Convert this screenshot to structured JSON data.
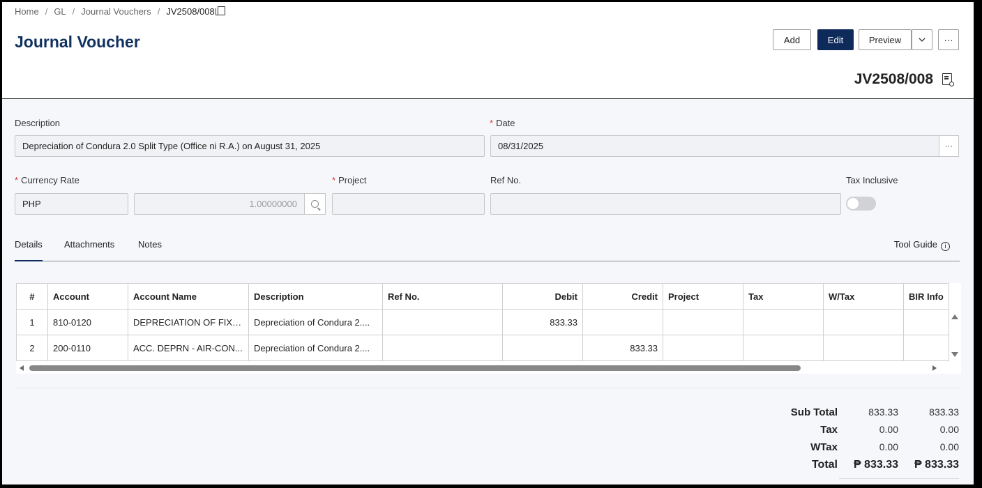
{
  "breadcrumb": [
    "Home",
    "GL",
    "Journal Vouchers",
    "JV2508/008"
  ],
  "page_title": "Journal Voucher",
  "toolbar": {
    "add": "Add",
    "edit": "Edit",
    "preview": "Preview",
    "dropdown_icon": "chevron-down-icon",
    "more": "···"
  },
  "doc_number": "JV2508/008",
  "form": {
    "description_label": "Description",
    "description_value": "Depreciation of Condura 2.0 Split Type (Office ni R.A.) on August 31, 2025",
    "date_label": "Date",
    "date_value": "08/31/2025",
    "date_more": "···",
    "currency_label": "Currency Rate",
    "currency_value": "PHP",
    "rate_value": "1.00000000",
    "project_label": "Project",
    "project_value": "",
    "ref_label": "Ref No.",
    "ref_value": "",
    "tax_inclusive_label": "Tax Inclusive",
    "tax_inclusive_on": false
  },
  "tabs": [
    "Details",
    "Attachments",
    "Notes"
  ],
  "active_tab": "Details",
  "tool_guide": "Tool Guide",
  "info_glyph": "i",
  "grid": {
    "columns": [
      "#",
      "Account",
      "Account Name",
      "Description",
      "Ref No.",
      "Debit",
      "Credit",
      "Project",
      "Tax",
      "W/Tax",
      "BIR Info"
    ],
    "rows": [
      {
        "no": "1",
        "account": "810-0120",
        "account_name": "DEPRECIATION OF FIXE...",
        "description": "Depreciation of Condura 2....",
        "ref_no": "",
        "debit": "833.33",
        "credit": "",
        "project": "",
        "tax": "",
        "wtax": "",
        "bir": ""
      },
      {
        "no": "2",
        "account": "200-0110",
        "account_name": "ACC. DEPRN - AIR-CON...",
        "description": "Depreciation of Condura 2....",
        "ref_no": "",
        "debit": "",
        "credit": "833.33",
        "project": "",
        "tax": "",
        "wtax": "",
        "bir": ""
      }
    ]
  },
  "totals": [
    {
      "label": "Sub Total",
      "debit": "833.33",
      "credit": "833.33"
    },
    {
      "label": "Tax",
      "debit": "0.00",
      "credit": "0.00"
    },
    {
      "label": "WTax",
      "debit": "0.00",
      "credit": "0.00"
    },
    {
      "label": "Total",
      "debit": "₱ 833.33",
      "credit": "₱ 833.33"
    }
  ],
  "colors": {
    "brand": "#0e2a5a",
    "title": "#10305f",
    "required": "#dd3333"
  }
}
